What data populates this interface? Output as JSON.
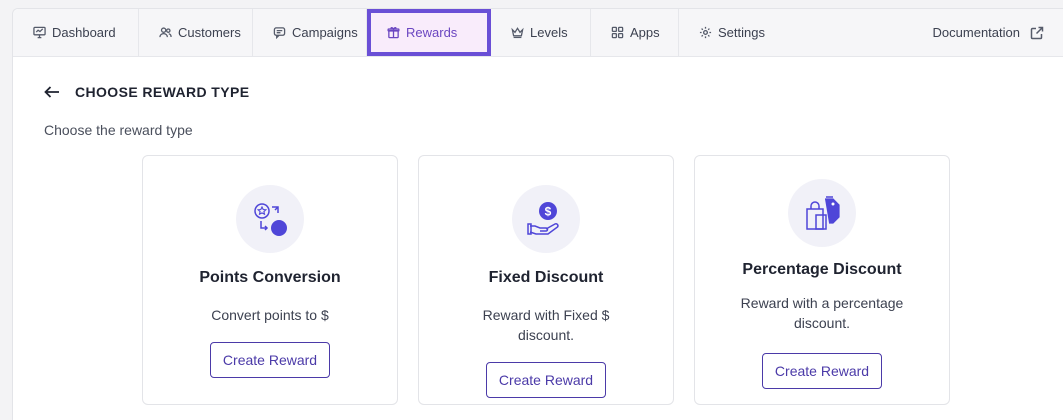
{
  "nav": {
    "tabs": [
      {
        "id": "dashboard",
        "label": "Dashboard",
        "icon": "dashboard-icon"
      },
      {
        "id": "customers",
        "label": "Customers",
        "icon": "users-icon"
      },
      {
        "id": "campaigns",
        "label": "Campaigns",
        "icon": "chat-icon"
      },
      {
        "id": "rewards",
        "label": "Rewards",
        "icon": "gift-icon",
        "active": true
      },
      {
        "id": "levels",
        "label": "Levels",
        "icon": "crown-icon"
      },
      {
        "id": "apps",
        "label": "Apps",
        "icon": "grid-icon"
      },
      {
        "id": "settings",
        "label": "Settings",
        "icon": "gear-icon"
      }
    ],
    "documentation": {
      "label": "Documentation",
      "icon": "external-link-icon"
    }
  },
  "page": {
    "title": "CHOOSE REWARD TYPE",
    "subtitle": "Choose the reward type"
  },
  "cards": [
    {
      "title": "Points Conversion",
      "description": "Convert points to $",
      "button": "Create Reward",
      "icon": "points-conversion-icon"
    },
    {
      "title": "Fixed Discount",
      "description": "Reward with Fixed $ discount.",
      "button": "Create Reward",
      "icon": "dollar-hand-icon"
    },
    {
      "title": "Percentage Discount",
      "description": "Reward with a percentage discount.",
      "button": "Create Reward",
      "icon": "shopping-tags-icon"
    }
  ],
  "colors": {
    "accent": "#6a4fd6",
    "active_tab_bg": "#f9ecfb",
    "button_border": "#4b3aa8",
    "icon_fill": "#4f46d8"
  }
}
